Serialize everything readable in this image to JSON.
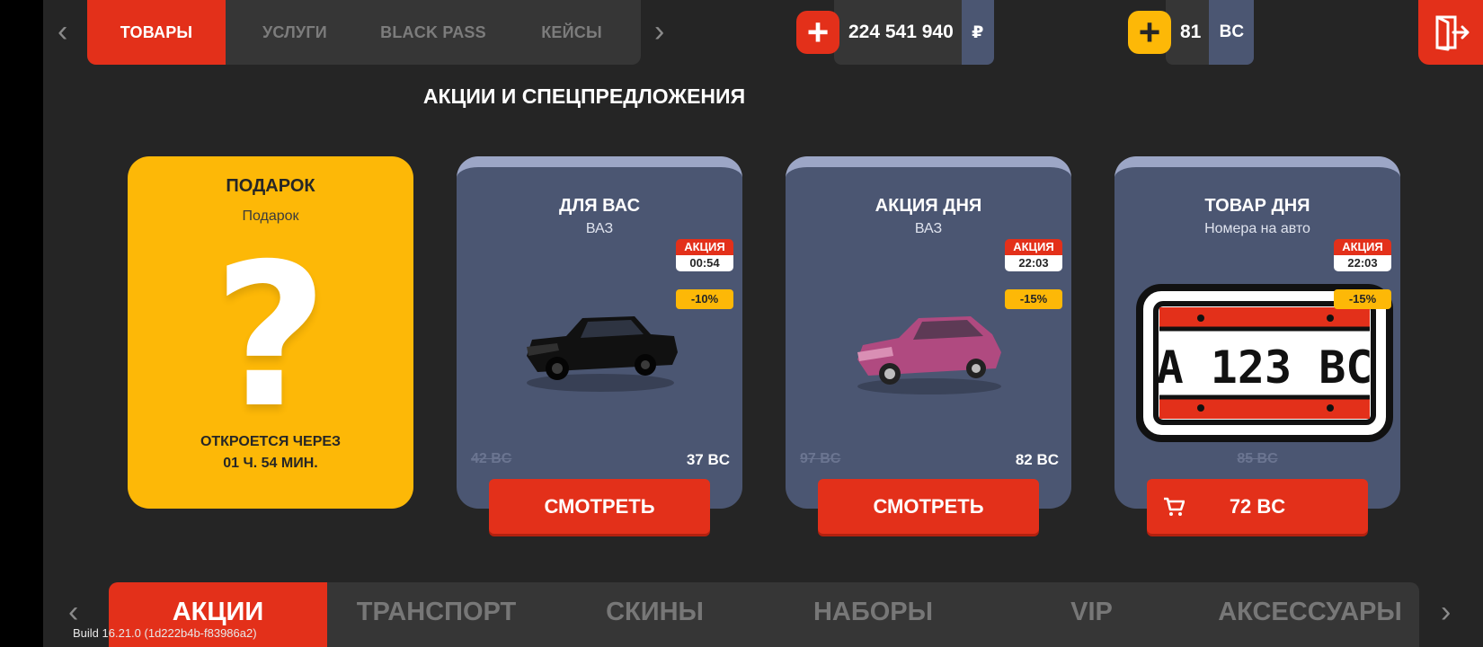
{
  "top_tabs": [
    {
      "label": "ТОВАРЫ",
      "active": true
    },
    {
      "label": "УСЛУГИ",
      "active": false
    },
    {
      "label": "BLACK PASS",
      "active": false
    },
    {
      "label": "КЕЙСЫ",
      "active": false
    }
  ],
  "wallet_rub": {
    "amount": "224 541 940",
    "currency": "₽",
    "plus": "+"
  },
  "wallet_bc": {
    "amount": "81",
    "currency": "BC",
    "plus": "+"
  },
  "section_title": "АКЦИИ И СПЕЦПРЕДЛОЖЕНИЯ",
  "gift": {
    "title": "ПОДАРОК",
    "subtitle": "Подарок",
    "symbol": "?",
    "opens_line1": "ОТКРОЕТСЯ ЧЕРЕЗ",
    "opens_line2": "01 Ч. 54 МИН."
  },
  "cards": [
    {
      "title": "ДЛЯ ВАС",
      "subtitle": "ВАЗ",
      "badge": "АКЦИЯ",
      "timer": "00:54",
      "discount": "-10%",
      "old_price": "42 BC",
      "new_price": "37 BC",
      "button": "СМОТРЕТЬ",
      "car_color": "#111111"
    },
    {
      "title": "АКЦИЯ ДНЯ",
      "subtitle": "ВАЗ",
      "badge": "АКЦИЯ",
      "timer": "22:03",
      "discount": "-15%",
      "old_price": "97 BC",
      "new_price": "82 BC",
      "button": "СМОТРЕТЬ",
      "car_color": "#b04a80"
    },
    {
      "title": "ТОВАР ДНЯ",
      "subtitle": "Номера на авто",
      "badge": "АКЦИЯ",
      "timer": "22:03",
      "discount": "-15%",
      "old_price": "85 BC",
      "button": "72 BC",
      "plate_text": "A 123 BC"
    }
  ],
  "categories": [
    {
      "label": "АКЦИИ",
      "active": true
    },
    {
      "label": "ТРАНСПОРТ",
      "active": false
    },
    {
      "label": "СКИНЫ",
      "active": false
    },
    {
      "label": "НАБОРЫ",
      "active": false
    },
    {
      "label": "VIP",
      "active": false
    },
    {
      "label": "АКСЕССУАРЫ",
      "active": false
    }
  ],
  "build": "Build 16.21.0 (1d222b4b-f83986a2)",
  "colors": {
    "accent": "#e3301a",
    "gold": "#fdb807",
    "card": "#4b5672",
    "panel": "#363636"
  }
}
